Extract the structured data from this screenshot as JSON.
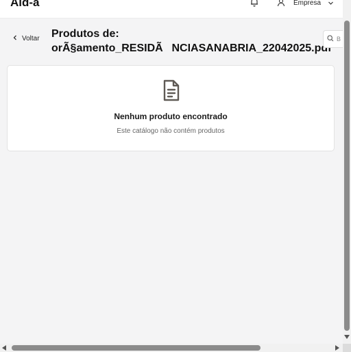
{
  "header": {
    "brand": "Ald-a",
    "user_menu_label": "Empresa"
  },
  "page": {
    "back_label": "Voltar",
    "title_line1": "Produtos de:",
    "title_line2": "orÃ§amento_RESIDÃNCIASANABRIA_22042025.pdf",
    "search_placeholder": "B"
  },
  "empty_state": {
    "icon": "document-icon",
    "title": "Nenhum produto encontrado",
    "subtitle": "Este catálogo não contém produtos"
  },
  "colors": {
    "icon_color": "#5f5a55",
    "scrollbar_thumb": "#8b8b8b"
  }
}
